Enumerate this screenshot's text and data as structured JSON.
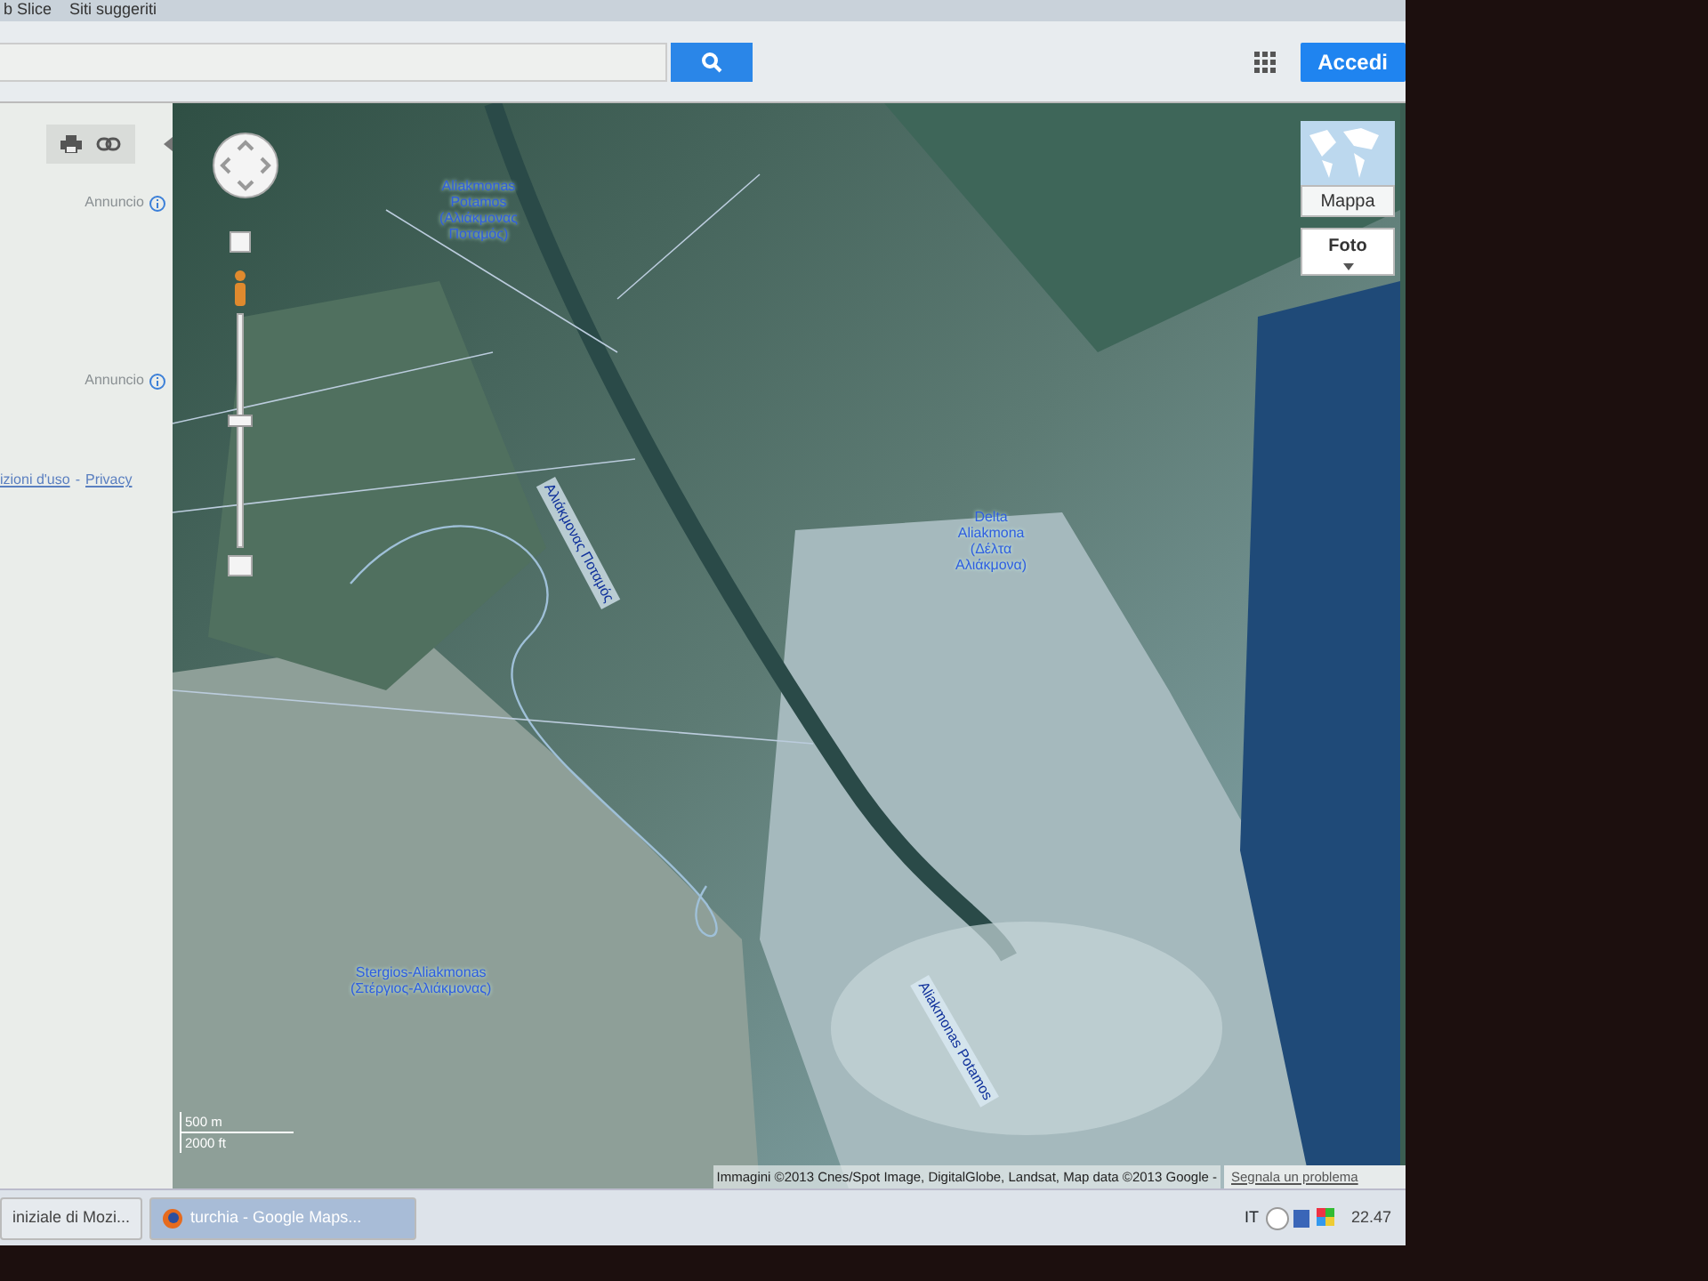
{
  "browser": {
    "bookmarks": [
      {
        "label": "b Slice"
      },
      {
        "label": "Siti suggeriti"
      }
    ]
  },
  "header": {
    "sign_in": "Accedi"
  },
  "sidebar": {
    "ads": [
      "Annuncio",
      "Annuncio"
    ],
    "footer_links": [
      "izioni d'uso",
      "Privacy"
    ],
    "separator": "-"
  },
  "map": {
    "labels": [
      {
        "kind": "place",
        "lines": [
          "Aliakmonas",
          "Potamos",
          "(Αλιάκμονας",
          "Ποταμός)"
        ]
      },
      {
        "kind": "river",
        "lines": [
          "Αλιάκμονας Ποταμός"
        ]
      },
      {
        "kind": "place",
        "lines": [
          "Delta",
          "Aliakmona",
          "(Δέλτα",
          "Αλιάκμονα)"
        ]
      },
      {
        "kind": "place",
        "lines": [
          "Stergios-Aliakmonas",
          "(Στέργιος-Αλιάκμονας)"
        ]
      },
      {
        "kind": "river",
        "lines": [
          "Aliakmonas Potamos"
        ]
      }
    ],
    "layer_buttons": [
      {
        "label": "Mappa",
        "selected": false
      },
      {
        "label": "Foto",
        "selected": true
      }
    ],
    "zoom": {
      "level": 0.55
    },
    "scale": [
      "500 m",
      "2000 ft"
    ],
    "attribution": "Immagini ©2013 Cnes/Spot Image, DigitalGlobe, Landsat, Map data ©2013 Google -",
    "report": "Segnala un problema"
  },
  "taskbar": {
    "tasks": [
      {
        "label": "iniziale di Mozi...",
        "selected": false
      },
      {
        "label": "turchia - Google Maps...",
        "selected": true
      }
    ],
    "language": "IT",
    "clock": "22.47"
  }
}
